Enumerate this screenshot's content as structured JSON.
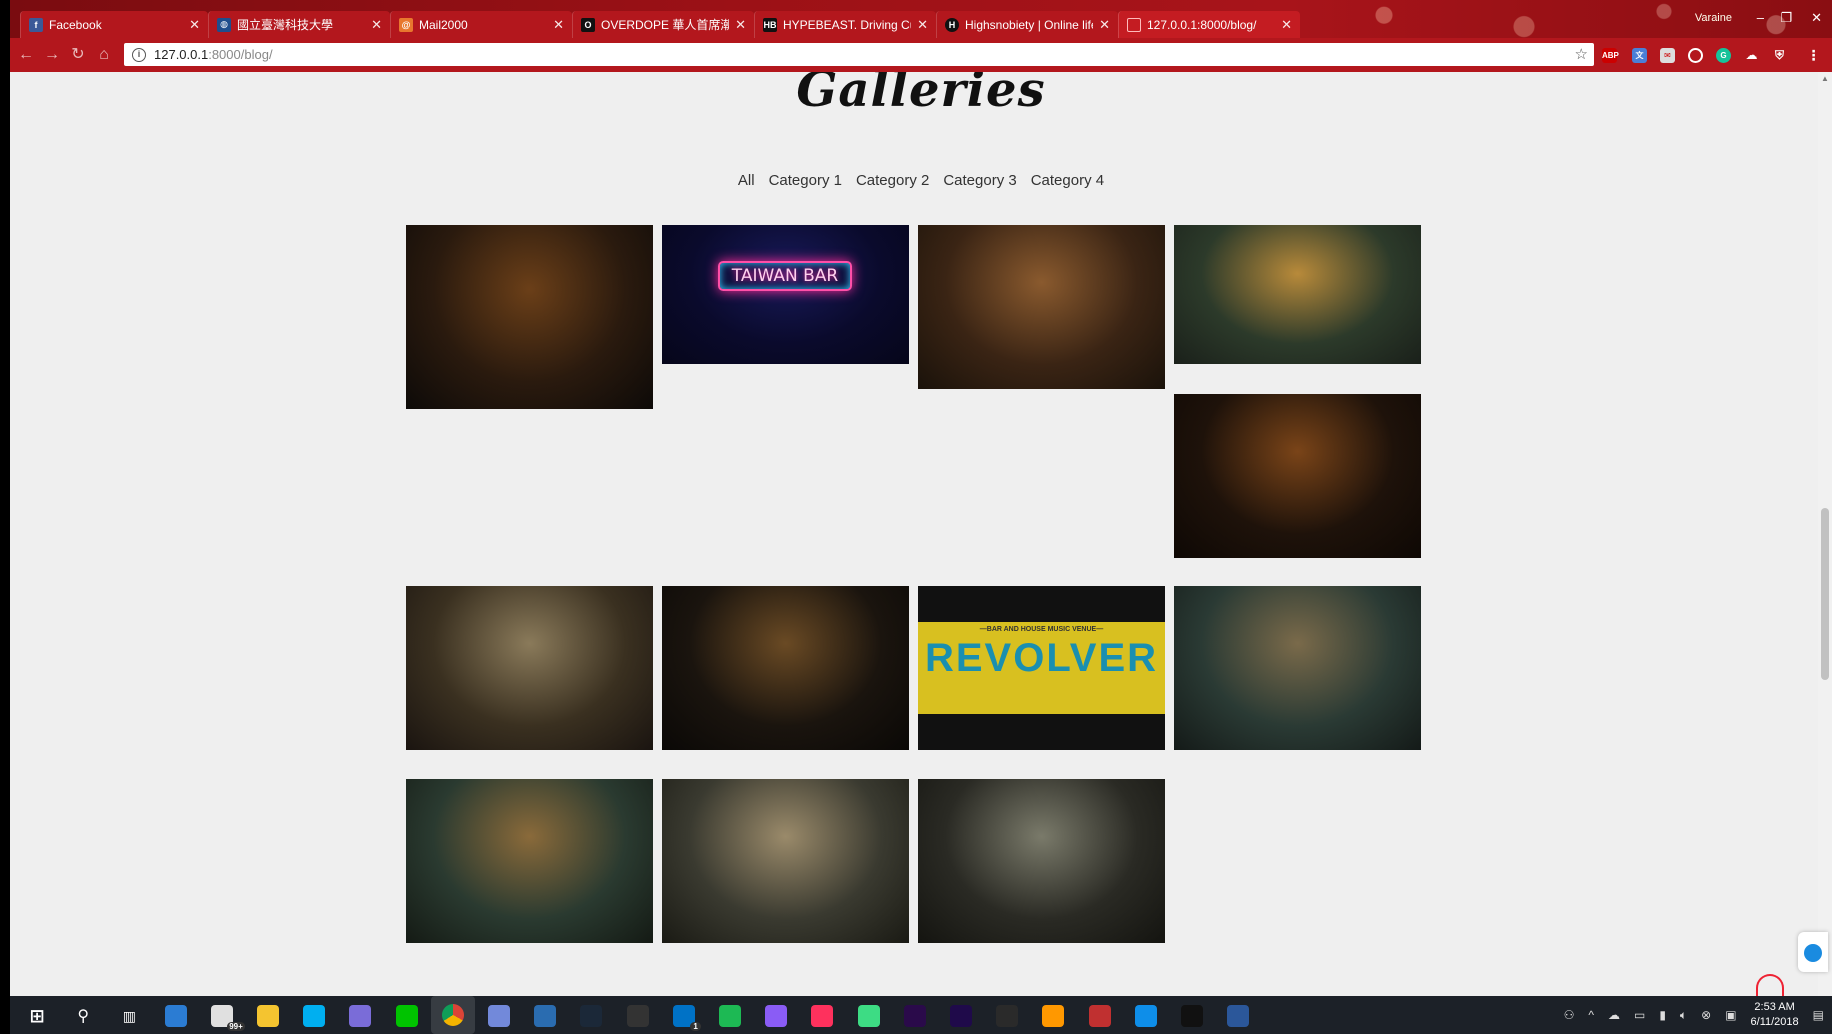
{
  "browser": {
    "tabs": [
      {
        "title": "Facebook",
        "favicon": "facebook-icon",
        "color": "#3b5998"
      },
      {
        "title": "國立臺灣科技大學",
        "favicon": "ntust-icon",
        "color": "#1e4d8c"
      },
      {
        "title": "Mail2000",
        "favicon": "mail2000-icon",
        "color": "#e8772e"
      },
      {
        "title": "OVERDOPE 華人首席潮上",
        "favicon": "overdope-icon",
        "color": "#111111"
      },
      {
        "title": "HYPEBEAST. Driving Cult",
        "favicon": "hypebeast-icon",
        "color": "#111111"
      },
      {
        "title": "Highsnobiety | Online life",
        "favicon": "highsnobiety-icon",
        "color": "#111111"
      },
      {
        "title": "127.0.0.1:8000/blog/",
        "favicon": "page-icon",
        "color": "#ffffff"
      }
    ],
    "window_user": "Varaine",
    "address": {
      "host": "127.0.0.1",
      "path": ":8000/blog/"
    }
  },
  "page": {
    "title": "Galleries",
    "filters": [
      "All",
      "Category 1",
      "Category 2",
      "Category 3",
      "Category 4"
    ],
    "photos": [
      {
        "name": "photo-bar-interior-crowd",
        "colors": [
          "#2a1a0e",
          "#6b3f18",
          "#0d0a08"
        ]
      },
      {
        "name": "photo-taiwan-bar-neon-sign",
        "colors": [
          "#0a0a2c",
          "#181a5a",
          "#06061a"
        ],
        "sign": "TAIWAN BAR"
      },
      {
        "name": "photo-bartender-pouring-beer",
        "colors": [
          "#3a2414",
          "#8a5a2e",
          "#1a120a"
        ]
      },
      {
        "name": "photo-beer-glass-tap",
        "colors": [
          "#2c3a2a",
          "#b88a3a",
          "#1a201a"
        ]
      },
      {
        "name": "photo-three-pints-beer",
        "colors": [
          "#1e120a",
          "#7a4418",
          "#0e0804"
        ]
      },
      {
        "name": "photo-two-friends-smiling",
        "colors": [
          "#3a3020",
          "#8a7a5a",
          "#1a1410"
        ]
      },
      {
        "name": "photo-dark-bar-counter",
        "colors": [
          "#1a140e",
          "#6a4a24",
          "#0a0806"
        ]
      },
      {
        "name": "photo-revolver-sign",
        "colors": [
          "#2a2410",
          "#d8c020",
          "#101010"
        ],
        "sign": "REVOLVER",
        "subsign": "—BAR AND HOUSE MUSIC VENUE—"
      },
      {
        "name": "photo-bar-patrons-green",
        "colors": [
          "#2a3a34",
          "#7a6a4a",
          "#141a18"
        ]
      },
      {
        "name": "photo-bar-people-back",
        "colors": [
          "#2a3a30",
          "#8a6a3a",
          "#141a14"
        ]
      },
      {
        "name": "photo-man-cap-thinking",
        "colors": [
          "#3a3a30",
          "#9a8a6a",
          "#1a1a14"
        ]
      },
      {
        "name": "photo-friends-adidas-shirt",
        "colors": [
          "#2a2a24",
          "#7a7a6a",
          "#141410"
        ]
      }
    ]
  },
  "taskbar": {
    "icons": [
      "windows-start-icon",
      "search-icon",
      "task-view-icon",
      "store-icon",
      "mail-badge-icon",
      "file-explorer-icon",
      "skype-icon",
      "cortana-icon",
      "line-icon",
      "chrome-icon",
      "discord-icon",
      "visual-studio-icon",
      "steam-icon",
      "epic-games-icon",
      "outlook-icon",
      "spotify-icon",
      "messenger-icon",
      "intellij-icon",
      "android-studio-icon",
      "premiere-icon",
      "after-effects-icon",
      "nox-icon",
      "sublime-icon",
      "flag-app-icon",
      "teamviewer-icon",
      "terminal-icon",
      "word-icon"
    ],
    "mail_badge": "99+",
    "outlook_badge": "1",
    "time": "2:53 AM",
    "date": "6/11/2018"
  }
}
